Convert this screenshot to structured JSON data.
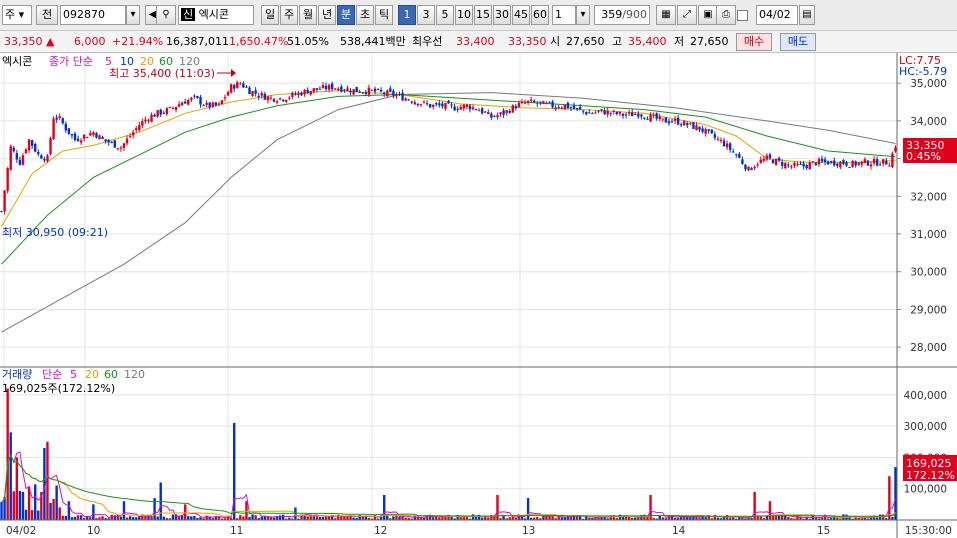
{
  "toolbar": {
    "market_label": "주",
    "prev_label": "전",
    "code": "092870",
    "badge": "신",
    "stock_name": "엑시콘",
    "period_tabs": [
      "일",
      "주",
      "월",
      "년",
      "분",
      "초",
      "틱"
    ],
    "minute_values": [
      "1",
      "3",
      "5",
      "10",
      "15",
      "30",
      "45",
      "60"
    ],
    "interval_value": "1",
    "count_value": "359",
    "count_max": "/900",
    "date_value": "04/02"
  },
  "quote": {
    "price": "33,350",
    "arrow": "▲",
    "change": "6,000",
    "change_pct": "+21.94%",
    "volume": "16,387,011",
    "volume_ratio": "1,650.47%",
    "strength": "51.05%",
    "amount": "538,441백만",
    "best_label": "최우선",
    "best_ask": "33,400",
    "best_bid": "33,350",
    "open_label": "시",
    "open": "27,650",
    "high_label": "고",
    "high": "35,400",
    "low_label": "저",
    "low": "27,650",
    "buy_label": "매수",
    "sell_label": "매도"
  },
  "colors": {
    "up": "#e0001b",
    "down": "#0032c8",
    "ma5": "#d40bd4",
    "ma10": "#0032c8",
    "ma20": "#e6a300",
    "ma60": "#1e8f1e",
    "ma120": "#7a7a7a"
  },
  "chart_data": [
    {
      "type": "candlestick",
      "legend": {
        "name": "엑시콘",
        "ma_label": "종가 단순",
        "periods": [
          "5",
          "10",
          "20",
          "60",
          "120"
        ]
      },
      "ylim": [
        27500,
        35800
      ],
      "y_ticks": [
        "35,000",
        "34,000",
        "33,000",
        "32,000",
        "31,000",
        "30,000",
        "29,000",
        "28,000"
      ],
      "x_ticks": [
        "04/02",
        "10",
        "11",
        "12",
        "13",
        "14",
        "15",
        "15:30:00"
      ],
      "high_annotation": "최고 35,400 (11:03)",
      "low_annotation": "최저 30,950 (09:21)",
      "lc": "LC:7.75",
      "hc": "HC:-5.79",
      "last_price": "33,350",
      "last_pct": "0.45%",
      "price_path": [
        [
          0,
          31600
        ],
        [
          3,
          33300
        ],
        [
          6,
          32900
        ],
        [
          9,
          33500
        ],
        [
          12,
          33100
        ],
        [
          15,
          33000
        ],
        [
          17,
          34100
        ],
        [
          19,
          34050
        ],
        [
          21,
          33800
        ],
        [
          24,
          33500
        ],
        [
          27,
          33600
        ],
        [
          30,
          33700
        ],
        [
          33,
          33500
        ],
        [
          36,
          33400
        ],
        [
          39,
          33300
        ],
        [
          42,
          33600
        ],
        [
          45,
          33900
        ],
        [
          48,
          34100
        ],
        [
          51,
          34200
        ],
        [
          55,
          34300
        ],
        [
          59,
          34500
        ],
        [
          63,
          34600
        ],
        [
          67,
          34400
        ],
        [
          71,
          34400
        ],
        [
          75,
          34900
        ],
        [
          78,
          35000
        ],
        [
          81,
          34800
        ],
        [
          84,
          34700
        ],
        [
          88,
          34600
        ],
        [
          92,
          34600
        ],
        [
          96,
          34700
        ],
        [
          100,
          34800
        ],
        [
          104,
          34850
        ],
        [
          108,
          34900
        ],
        [
          112,
          34850
        ],
        [
          116,
          34800
        ],
        [
          120,
          34800
        ],
        [
          124,
          34750
        ],
        [
          128,
          34700
        ],
        [
          132,
          34600
        ],
        [
          136,
          34500
        ],
        [
          140,
          34400
        ],
        [
          144,
          34400
        ],
        [
          148,
          34350
        ],
        [
          152,
          34400
        ],
        [
          156,
          34300
        ],
        [
          160,
          34100
        ],
        [
          164,
          34200
        ],
        [
          168,
          34400
        ],
        [
          172,
          34500
        ],
        [
          176,
          34450
        ],
        [
          180,
          34400
        ],
        [
          184,
          34400
        ],
        [
          188,
          34300
        ],
        [
          192,
          34200
        ],
        [
          196,
          34250
        ],
        [
          200,
          34200
        ],
        [
          204,
          34150
        ],
        [
          208,
          34200
        ],
        [
          212,
          34100
        ],
        [
          216,
          34000
        ],
        [
          220,
          34000
        ],
        [
          224,
          33900
        ],
        [
          228,
          33800
        ],
        [
          232,
          33600
        ],
        [
          236,
          33400
        ],
        [
          240,
          33100
        ],
        [
          244,
          32700
        ],
        [
          247,
          32900
        ],
        [
          250,
          33000
        ],
        [
          254,
          32900
        ],
        [
          258,
          32800
        ],
        [
          262,
          32800
        ],
        [
          266,
          32900
        ],
        [
          270,
          32900
        ],
        [
          274,
          32900
        ],
        [
          278,
          32850
        ],
        [
          282,
          32900
        ],
        [
          286,
          32900
        ],
        [
          290,
          32900
        ],
        [
          292,
          33350
        ]
      ],
      "ma": [
        {
          "name": "20",
          "path": [
            [
              0,
              31200
            ],
            [
              10,
              32600
            ],
            [
              20,
              33200
            ],
            [
              30,
              33350
            ],
            [
              45,
              33700
            ],
            [
              60,
              34200
            ],
            [
              75,
              34500
            ],
            [
              90,
              34700
            ],
            [
              110,
              34800
            ],
            [
              130,
              34700
            ],
            [
              150,
              34450
            ],
            [
              170,
              34350
            ],
            [
              190,
              34300
            ],
            [
              210,
              34200
            ],
            [
              230,
              33900
            ],
            [
              240,
              33600
            ],
            [
              250,
              33000
            ],
            [
              262,
              32900
            ],
            [
              280,
              32900
            ],
            [
              292,
              32950
            ]
          ]
        },
        {
          "name": "60",
          "path": [
            [
              0,
              30200
            ],
            [
              15,
              31500
            ],
            [
              30,
              32500
            ],
            [
              45,
              33100
            ],
            [
              60,
              33700
            ],
            [
              75,
              34100
            ],
            [
              90,
              34400
            ],
            [
              110,
              34650
            ],
            [
              130,
              34700
            ],
            [
              150,
              34600
            ],
            [
              170,
              34500
            ],
            [
              190,
              34400
            ],
            [
              210,
              34300
            ],
            [
              230,
              34100
            ],
            [
              250,
              33600
            ],
            [
              270,
              33200
            ],
            [
              292,
              33050
            ]
          ]
        },
        {
          "name": "120",
          "path": [
            [
              0,
              28400
            ],
            [
              20,
              29300
            ],
            [
              40,
              30200
            ],
            [
              60,
              31300
            ],
            [
              75,
              32500
            ],
            [
              90,
              33500
            ],
            [
              110,
              34300
            ],
            [
              130,
              34700
            ],
            [
              160,
              34750
            ],
            [
              190,
              34600
            ],
            [
              220,
              34350
            ],
            [
              250,
              34000
            ],
            [
              270,
              33750
            ],
            [
              292,
              33400
            ]
          ]
        }
      ]
    },
    {
      "type": "bar",
      "legend": {
        "name": "거래량",
        "ma_label": "단순",
        "periods": [
          "5",
          "20",
          "60",
          "120"
        ]
      },
      "value_label": "169,025주(172.12%)",
      "ylim": [
        0,
        460000
      ],
      "y_ticks": [
        "400,000",
        "300,000",
        "200,000",
        "100,000"
      ],
      "last_value": "169,025",
      "last_pct": "172.12%",
      "peaks": [
        [
          2,
          420000
        ],
        [
          3,
          280000
        ],
        [
          5,
          200000
        ],
        [
          7,
          90000
        ],
        [
          14,
          230000
        ],
        [
          15,
          250000
        ],
        [
          18,
          110000
        ],
        [
          22,
          60000
        ],
        [
          30,
          50000
        ],
        [
          40,
          60000
        ],
        [
          50,
          70000
        ],
        [
          52,
          120000
        ],
        [
          60,
          50000
        ],
        [
          76,
          310000
        ],
        [
          80,
          60000
        ],
        [
          96,
          40000
        ],
        [
          125,
          80000
        ],
        [
          162,
          80000
        ],
        [
          172,
          70000
        ],
        [
          212,
          80000
        ],
        [
          246,
          90000
        ],
        [
          251,
          60000
        ],
        [
          290,
          140000
        ],
        [
          292,
          169025
        ]
      ]
    }
  ]
}
